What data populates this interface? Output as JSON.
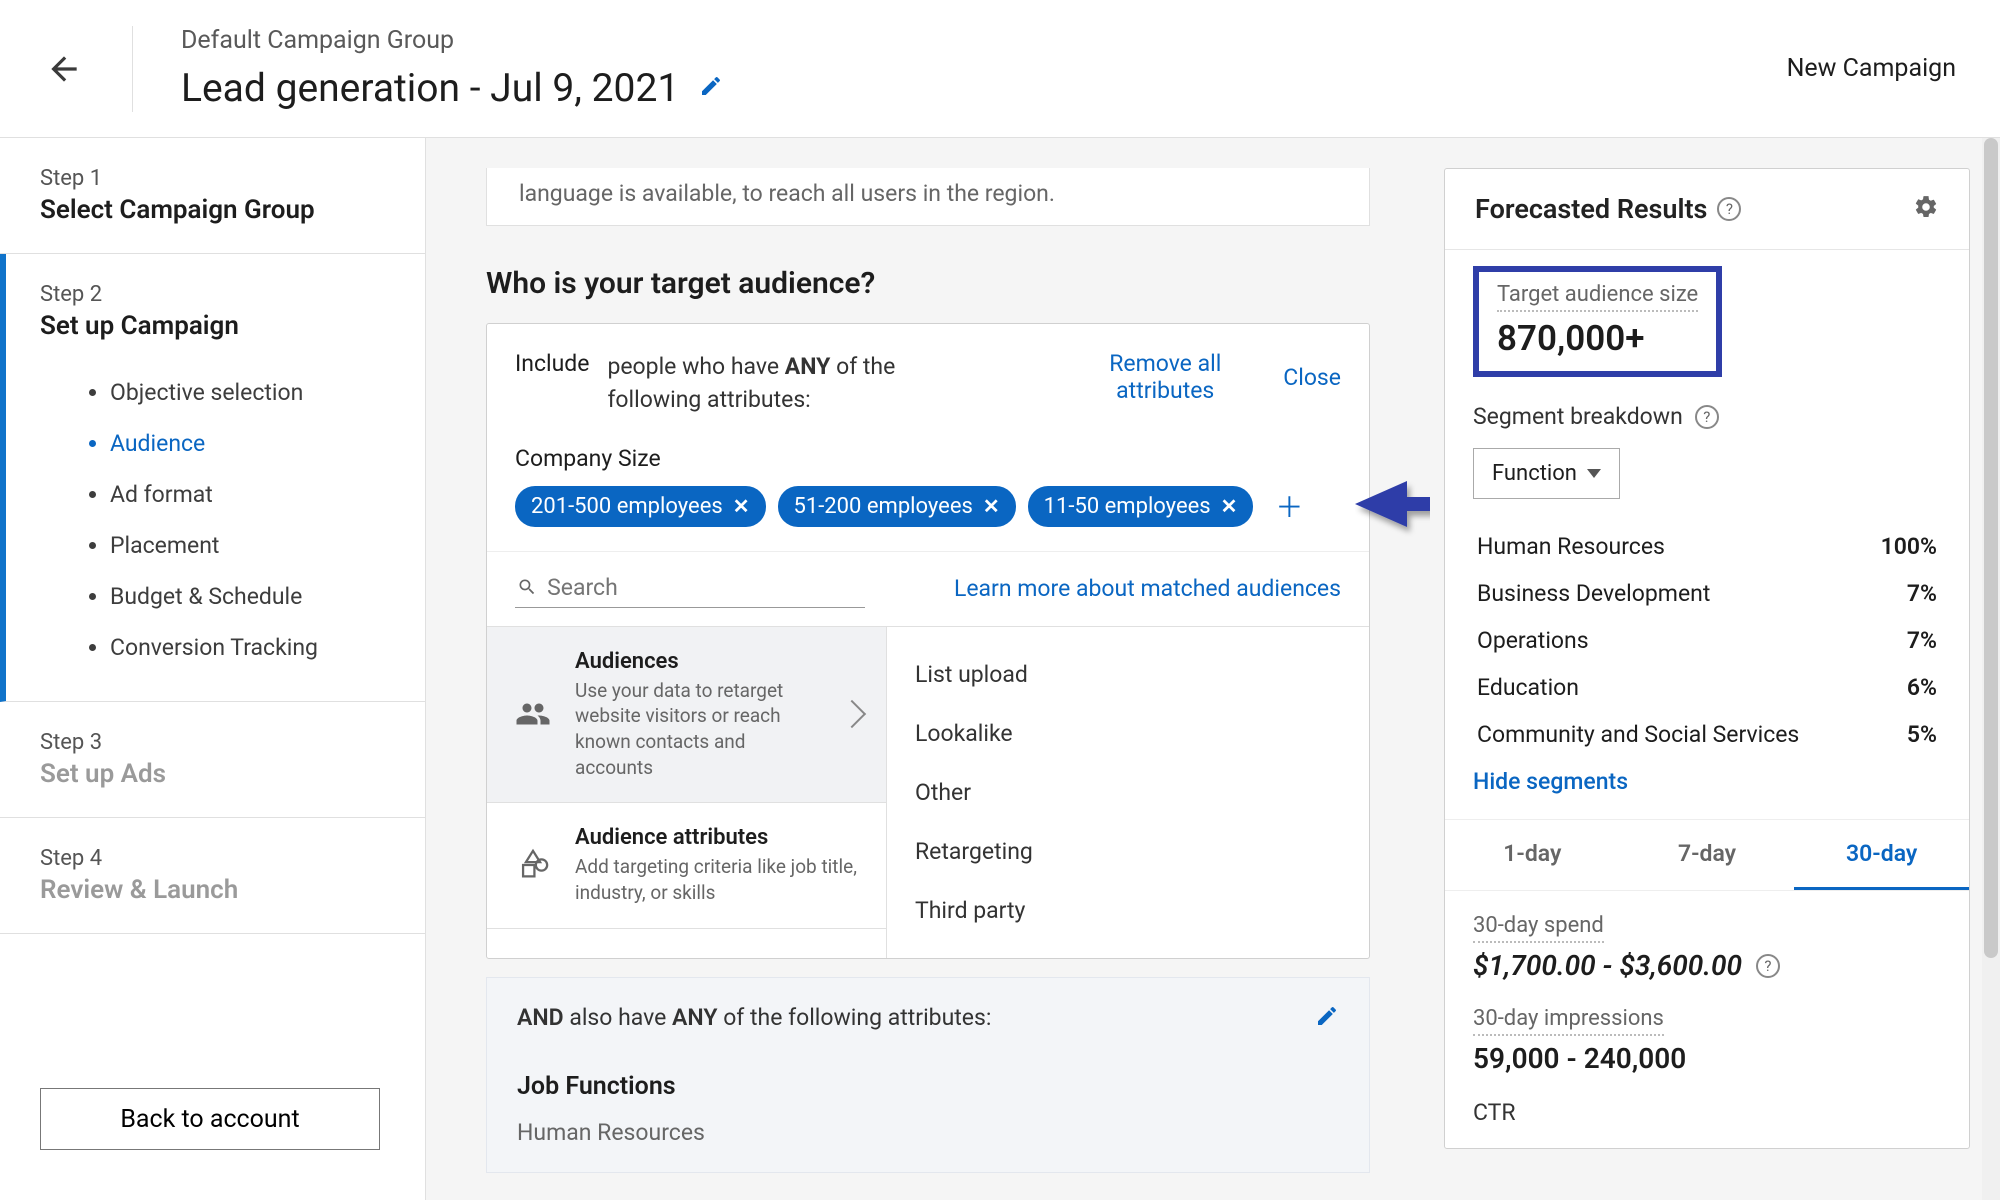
{
  "header": {
    "group_label": "Default Campaign Group",
    "campaign_title": "Lead generation - Jul 9, 2021",
    "new_campaign": "New Campaign"
  },
  "sidebar": {
    "step1": {
      "small": "Step 1",
      "title": "Select Campaign Group"
    },
    "step2": {
      "small": "Step 2",
      "title": "Set up Campaign",
      "items": [
        "Objective selection",
        "Audience",
        "Ad format",
        "Placement",
        "Budget & Schedule",
        "Conversion Tracking"
      ],
      "active_index": 1
    },
    "step3": {
      "small": "Step 3",
      "title": "Set up Ads"
    },
    "step4": {
      "small": "Step 4",
      "title": "Review & Launch"
    },
    "back_button": "Back to account"
  },
  "main": {
    "clipped_line": "language is available, to reach all users in the region.",
    "heading": "Who is your target audience?",
    "include": {
      "label": "Include",
      "text_pre": "people who have ",
      "text_bold": "ANY",
      "text_post": " of the following attributes:",
      "remove_all": "Remove all attributes",
      "close": "Close"
    },
    "section": {
      "title": "Company Size"
    },
    "chips": [
      "201-500 employees",
      "51-200 employees",
      "11-50 employees"
    ],
    "search": {
      "placeholder": "Search"
    },
    "learn_link": "Learn more about matched audiences",
    "cat_audiences": {
      "title": "Audiences",
      "desc": "Use your data to retarget website visitors or reach known contacts and accounts"
    },
    "cat_attrs": {
      "title": "Audience attributes",
      "desc": "Add targeting criteria like job title, industry, or skills"
    },
    "sub_options": [
      "List upload",
      "Lookalike",
      "Other",
      "Retargeting",
      "Third party"
    ],
    "and": {
      "pre": "AND",
      "mid": " also have ",
      "bold2": "ANY",
      "post": " of the following attributes:"
    },
    "jf_title": "Job Functions",
    "jf_value": "Human Resources"
  },
  "forecast": {
    "title": "Forecasted Results",
    "audience_size_label": "Target audience size",
    "audience_size_value": "870,000+",
    "segment_label": "Segment breakdown",
    "function_label": "Function",
    "segments": [
      {
        "name": "Human Resources",
        "pct": "100%"
      },
      {
        "name": "Business Development",
        "pct": "7%"
      },
      {
        "name": "Operations",
        "pct": "7%"
      },
      {
        "name": "Education",
        "pct": "6%"
      },
      {
        "name": "Community and Social Services",
        "pct": "5%"
      }
    ],
    "hide_link": "Hide segments",
    "tabs": [
      "1-day",
      "7-day",
      "30-day"
    ],
    "active_tab": 2,
    "spend_label": "30-day spend",
    "spend_value": "$1,700.00 - $3,600.00",
    "impr_label": "30-day impressions",
    "impr_value": "59,000 - 240,000",
    "ctr_label": "CTR"
  }
}
